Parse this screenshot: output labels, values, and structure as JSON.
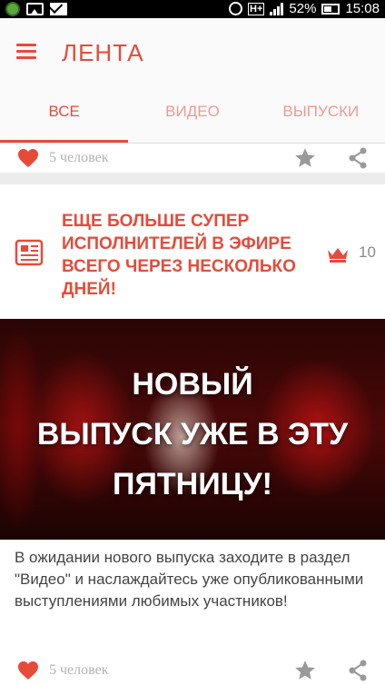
{
  "status_bar": {
    "network": "H+",
    "battery": "52%",
    "time": "15:08"
  },
  "app_bar": {
    "title": "ЛЕНТА"
  },
  "tabs": [
    {
      "label": "ВСЕ",
      "active": true
    },
    {
      "label": "ВИДЕО",
      "active": false
    },
    {
      "label": "ВЫПУСКИ",
      "active": false
    }
  ],
  "feed": {
    "top_card": {
      "likes_text": "5 человек"
    },
    "news_item": {
      "title": "ЕЩЕ БОЛЬШЕ СУПЕР ИСПОЛНИТЕЛЕЙ В ЭФИРЕ ВСЕГО ЧЕРЕЗ НЕСКОЛЬКО ДНЕЙ!",
      "count": "10"
    },
    "feature_card": {
      "image_headline_lines": [
        "НОВЫЙ",
        "ВЫПУСК УЖЕ В ЭТУ",
        "ПЯТНИЦУ!"
      ],
      "text": "В ожидании нового выпуска заходите в раздел \"Видео\" и наслаждайтесь уже опубликованными выступлениями любимых участников!",
      "likes_text": "5 человек"
    }
  },
  "colors": {
    "accent": "#e64b3a",
    "tab_inactive": "#ee9a90",
    "muted": "#b3b3b3",
    "icon_gray": "#9a9a9a"
  },
  "icons": {
    "menu": "hamburger-icon",
    "like": "heart-icon",
    "favorite": "star-icon",
    "share": "share-icon",
    "news": "newspaper-icon",
    "rating": "crown-icon"
  }
}
